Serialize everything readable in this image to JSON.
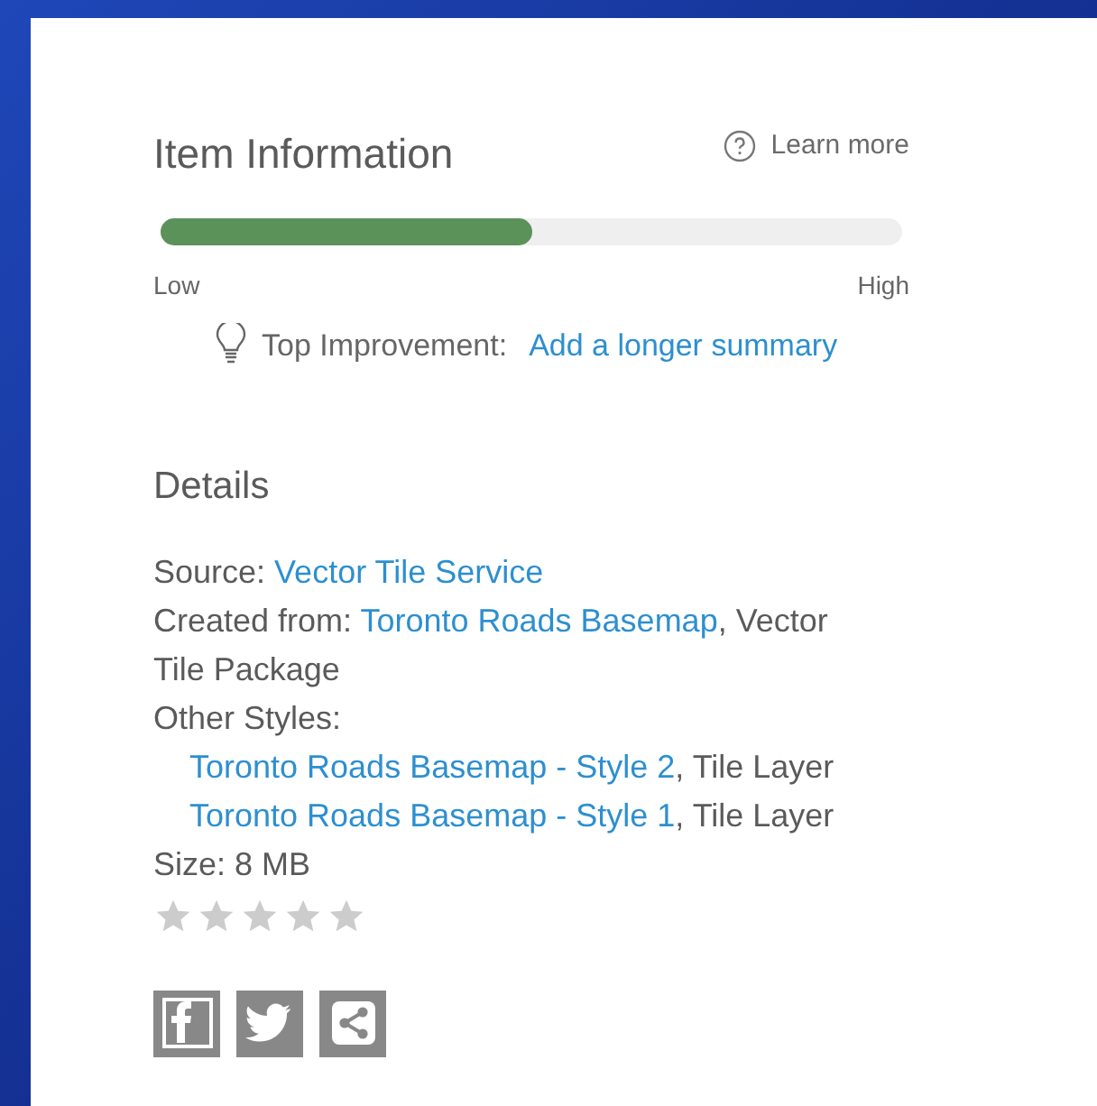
{
  "item_information": {
    "title": "Item Information",
    "help_link": "Learn more",
    "score": {
      "level": 0.5
    },
    "low_label": "Low",
    "high_label": "High",
    "improvement_label": "Top Improvement:",
    "improvement_link": "Add a longer summary"
  },
  "details": {
    "title": "Details",
    "lines": [
      {
        "indent": false,
        "segments": [
          {
            "text": "Source: ",
            "link": false
          },
          {
            "text": "Vector Tile Service",
            "link": true
          }
        ]
      },
      {
        "indent": false,
        "segments": [
          {
            "text": "Created from: ",
            "link": false
          },
          {
            "text": "Toronto Roads Basemap",
            "link": true
          },
          {
            "text": ", Vector Tile Package",
            "link": false
          }
        ]
      },
      {
        "indent": false,
        "segments": [
          {
            "text": "Other Styles:",
            "link": false
          }
        ]
      },
      {
        "indent": true,
        "segments": [
          {
            "text": "Toronto Roads Basemap - Style 2",
            "link": true
          },
          {
            "text": ", Tile Layer",
            "link": false
          }
        ]
      },
      {
        "indent": true,
        "segments": [
          {
            "text": "Toronto Roads Basemap - Style 1",
            "link": true
          },
          {
            "text": ", Tile Layer",
            "link": false
          }
        ]
      },
      {
        "indent": false,
        "segments": [
          {
            "text": "Size: 8 MB",
            "link": false
          }
        ]
      }
    ],
    "rating": {
      "stars": 0
    }
  },
  "share": [
    {
      "kind": "facebook"
    },
    {
      "kind": "twitter"
    },
    {
      "kind": "share"
    }
  ]
}
